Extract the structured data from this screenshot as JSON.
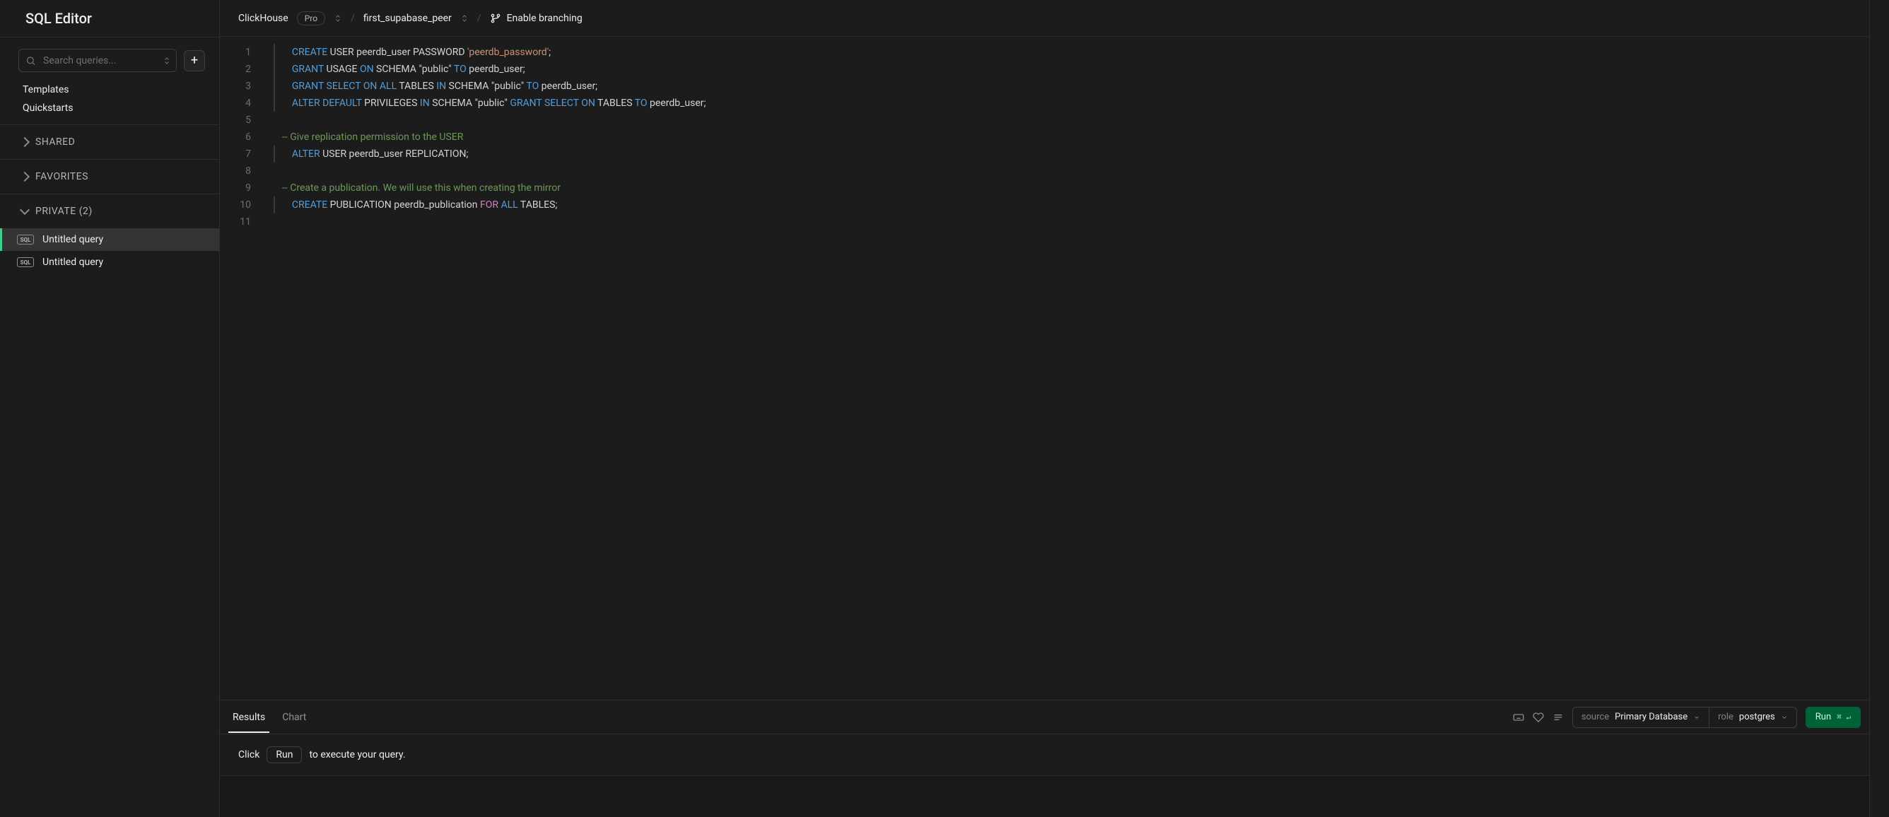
{
  "sidebar": {
    "title": "SQL Editor",
    "search_placeholder": "Search queries...",
    "links": {
      "templates": "Templates",
      "quickstarts": "Quickstarts"
    },
    "sections": {
      "shared": "SHARED",
      "favorites": "FAVORITES",
      "private": "PRIVATE (2)"
    },
    "private_items": [
      {
        "label": "Untitled query",
        "active": true
      },
      {
        "label": "Untitled query",
        "active": false
      }
    ]
  },
  "topbar": {
    "project": "ClickHouse",
    "plan": "Pro",
    "peer": "first_supabase_peer",
    "branching": "Enable branching"
  },
  "editor": {
    "line_numbers": [
      "1",
      "2",
      "3",
      "4",
      "5",
      "6",
      "7",
      "8",
      "9",
      "10",
      "11"
    ],
    "lines": [
      [
        {
          "t": "    ",
          "c": "tk-txt"
        },
        {
          "t": "CREATE",
          "c": "tk-kw"
        },
        {
          "t": " USER peerdb_user PASSWORD ",
          "c": "tk-txt"
        },
        {
          "t": "'peerdb_password'",
          "c": "tk-str"
        },
        {
          "t": ";",
          "c": "tk-txt"
        }
      ],
      [
        {
          "t": "    ",
          "c": "tk-txt"
        },
        {
          "t": "GRANT",
          "c": "tk-kw"
        },
        {
          "t": " USAGE ",
          "c": "tk-txt"
        },
        {
          "t": "ON",
          "c": "tk-kw"
        },
        {
          "t": " SCHEMA \"public\" ",
          "c": "tk-txt"
        },
        {
          "t": "TO",
          "c": "tk-kw"
        },
        {
          "t": " peerdb_user;",
          "c": "tk-txt"
        }
      ],
      [
        {
          "t": "    ",
          "c": "tk-txt"
        },
        {
          "t": "GRANT",
          "c": "tk-kw"
        },
        {
          "t": " ",
          "c": "tk-txt"
        },
        {
          "t": "SELECT",
          "c": "tk-kw"
        },
        {
          "t": " ",
          "c": "tk-txt"
        },
        {
          "t": "ON",
          "c": "tk-kw"
        },
        {
          "t": " ",
          "c": "tk-txt"
        },
        {
          "t": "ALL",
          "c": "tk-kw"
        },
        {
          "t": " TABLES ",
          "c": "tk-txt"
        },
        {
          "t": "IN",
          "c": "tk-kw"
        },
        {
          "t": " SCHEMA \"public\" ",
          "c": "tk-txt"
        },
        {
          "t": "TO",
          "c": "tk-kw"
        },
        {
          "t": " peerdb_user;",
          "c": "tk-txt"
        }
      ],
      [
        {
          "t": "    ",
          "c": "tk-txt"
        },
        {
          "t": "ALTER",
          "c": "tk-kw"
        },
        {
          "t": " ",
          "c": "tk-txt"
        },
        {
          "t": "DEFAULT",
          "c": "tk-kw"
        },
        {
          "t": " PRIVILEGES ",
          "c": "tk-txt"
        },
        {
          "t": "IN",
          "c": "tk-kw"
        },
        {
          "t": " SCHEMA \"public\" ",
          "c": "tk-txt"
        },
        {
          "t": "GRANT",
          "c": "tk-kw"
        },
        {
          "t": " ",
          "c": "tk-txt"
        },
        {
          "t": "SELECT",
          "c": "tk-kw"
        },
        {
          "t": " ",
          "c": "tk-txt"
        },
        {
          "t": "ON",
          "c": "tk-kw"
        },
        {
          "t": " TABLES ",
          "c": "tk-txt"
        },
        {
          "t": "TO",
          "c": "tk-kw"
        },
        {
          "t": " peerdb_user;",
          "c": "tk-txt"
        }
      ],
      [],
      [
        {
          "t": "-- Give replication permission to the USER",
          "c": "tk-cm"
        }
      ],
      [
        {
          "t": "    ",
          "c": "tk-txt"
        },
        {
          "t": "ALTER",
          "c": "tk-kw"
        },
        {
          "t": " USER peerdb_user REPLICATION;",
          "c": "tk-txt"
        }
      ],
      [],
      [
        {
          "t": "-- Create a publication. We will use this when creating the mirror",
          "c": "tk-cm"
        }
      ],
      [
        {
          "t": "    ",
          "c": "tk-txt"
        },
        {
          "t": "CREATE",
          "c": "tk-kw"
        },
        {
          "t": " PUBLICATION peerdb_publication ",
          "c": "tk-txt"
        },
        {
          "t": "FOR",
          "c": "tk-kw2"
        },
        {
          "t": " ",
          "c": "tk-txt"
        },
        {
          "t": "ALL",
          "c": "tk-kw"
        },
        {
          "t": " TABLES;",
          "c": "tk-txt"
        }
      ],
      []
    ]
  },
  "results": {
    "tabs": {
      "results": "Results",
      "chart": "Chart"
    },
    "source_label": "source",
    "source_value": "Primary Database",
    "role_label": "role",
    "role_value": "postgres",
    "run": "Run",
    "run_shortcut": "⌘  ↵",
    "hint_pre": "Click",
    "hint_pill": "Run",
    "hint_post": "to execute your query."
  }
}
